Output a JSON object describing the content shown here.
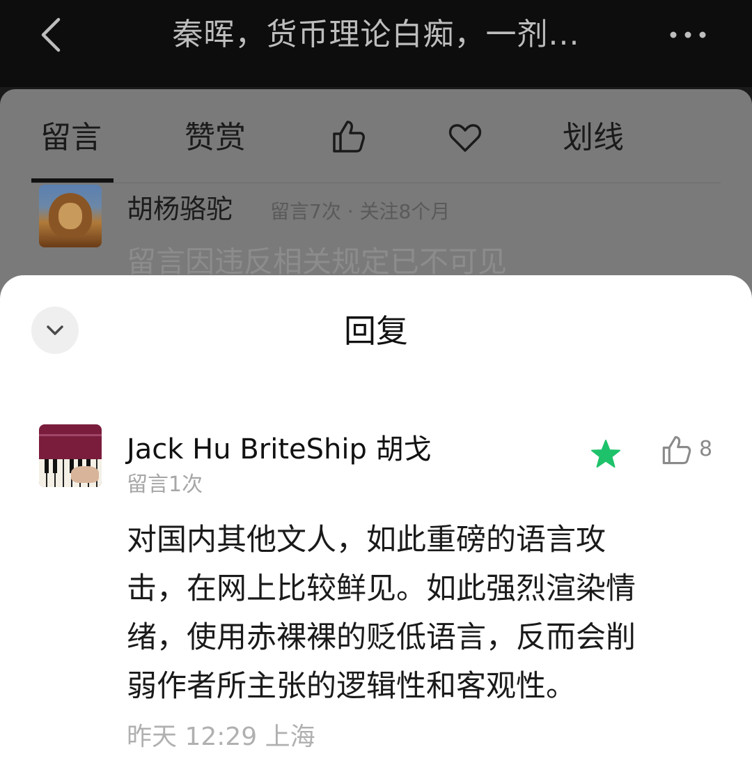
{
  "header": {
    "title": "秦晖，货币理论白痴，一剂...",
    "back_icon": "chevron-left-icon",
    "more_icon": "more-horizontal-icon"
  },
  "tabs": [
    {
      "label": "留言",
      "active": true
    },
    {
      "label": "赞赏"
    },
    {
      "label": "",
      "icon": "thumbs-up-icon"
    },
    {
      "label": "",
      "icon": "heart-icon"
    },
    {
      "label": "划线"
    }
  ],
  "background_comment": {
    "name": "胡杨骆驼",
    "meta": "留言7次 · 关注8个月",
    "text": "留言因违反相关规定已不可见"
  },
  "reply_sheet": {
    "title": "回复",
    "collapse_icon": "chevron-down-icon",
    "comment": {
      "name": "Jack Hu BriteShip 胡戈",
      "count": "留言1次",
      "starred": true,
      "star_color": "#1ec26a",
      "likes": "8",
      "body": "对国内其他文人，如此重磅的语言攻\n击，在网上比较鲜见。如此强烈渲染情\n绪，使用赤裸裸的贬低语言，反而会削\n弱作者所主张的逻辑性和客观性。",
      "time": "昨天 12:29  上海"
    }
  }
}
